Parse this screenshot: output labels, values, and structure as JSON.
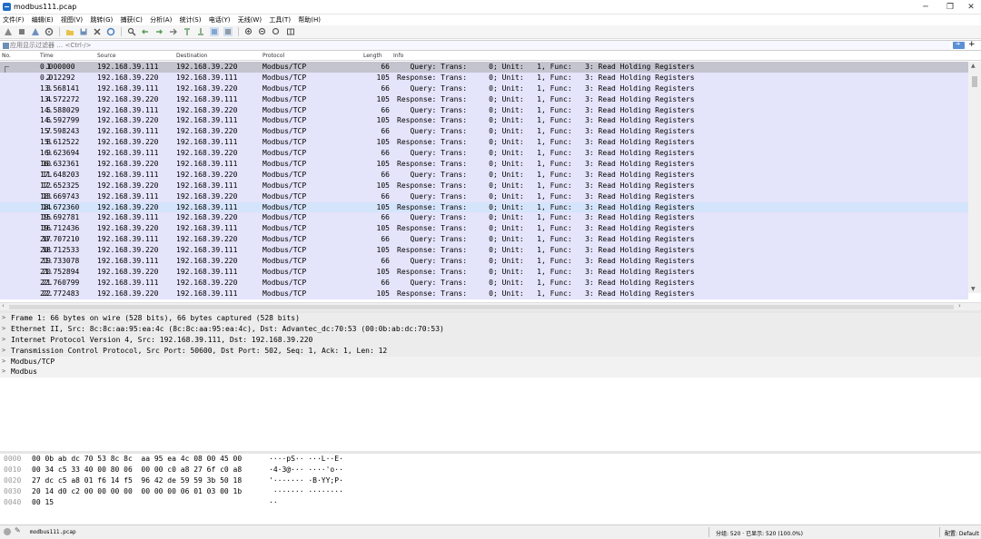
{
  "window": {
    "title": "modbus111.pcap",
    "minimize": "─",
    "maximize": "❐",
    "close": "✕"
  },
  "menu": [
    "文件(F)",
    "编辑(E)",
    "视图(V)",
    "跳转(G)",
    "捕获(C)",
    "分析(A)",
    "统计(S)",
    "电话(Y)",
    "无线(W)",
    "工具(T)",
    "帮助(H)"
  ],
  "filter": {
    "placeholder": "应用显示过滤器 … <Ctrl-/>",
    "plus": "+"
  },
  "columns": {
    "no": "No.",
    "time": "Time",
    "source": "Source",
    "destination": "Destination",
    "protocol": "Protocol",
    "length": "Length",
    "info": "Info"
  },
  "packets": [
    {
      "no": "1",
      "time": "0.000000",
      "src": "192.168.39.111",
      "dst": "192.168.39.220",
      "proto": "Modbus/TCP",
      "len": "66",
      "info": "   Query: Trans:     0; Unit:   1, Func:   3: Read Holding Registers"
    },
    {
      "no": "2",
      "time": "0.012292",
      "src": "192.168.39.220",
      "dst": "192.168.39.111",
      "proto": "Modbus/TCP",
      "len": "105",
      "info": "Response: Trans:     0; Unit:   1, Func:   3: Read Holding Registers"
    },
    {
      "no": "3",
      "time": "13.568141",
      "src": "192.168.39.111",
      "dst": "192.168.39.220",
      "proto": "Modbus/TCP",
      "len": "66",
      "info": "   Query: Trans:     0; Unit:   1, Func:   3: Read Holding Registers"
    },
    {
      "no": "4",
      "time": "13.572272",
      "src": "192.168.39.220",
      "dst": "192.168.39.111",
      "proto": "Modbus/TCP",
      "len": "105",
      "info": "Response: Trans:     0; Unit:   1, Func:   3: Read Holding Registers"
    },
    {
      "no": "5",
      "time": "14.588029",
      "src": "192.168.39.111",
      "dst": "192.168.39.220",
      "proto": "Modbus/TCP",
      "len": "66",
      "info": "   Query: Trans:     0; Unit:   1, Func:   3: Read Holding Registers"
    },
    {
      "no": "6",
      "time": "14.592799",
      "src": "192.168.39.220",
      "dst": "192.168.39.111",
      "proto": "Modbus/TCP",
      "len": "105",
      "info": "Response: Trans:     0; Unit:   1, Func:   3: Read Holding Registers"
    },
    {
      "no": "7",
      "time": "15.598243",
      "src": "192.168.39.111",
      "dst": "192.168.39.220",
      "proto": "Modbus/TCP",
      "len": "66",
      "info": "   Query: Trans:     0; Unit:   1, Func:   3: Read Holding Registers"
    },
    {
      "no": "8",
      "time": "15.612522",
      "src": "192.168.39.220",
      "dst": "192.168.39.111",
      "proto": "Modbus/TCP",
      "len": "105",
      "info": "Response: Trans:     0; Unit:   1, Func:   3: Read Holding Registers"
    },
    {
      "no": "9",
      "time": "16.623694",
      "src": "192.168.39.111",
      "dst": "192.168.39.220",
      "proto": "Modbus/TCP",
      "len": "66",
      "info": "   Query: Trans:     0; Unit:   1, Func:   3: Read Holding Registers"
    },
    {
      "no": "10",
      "time": "16.632361",
      "src": "192.168.39.220",
      "dst": "192.168.39.111",
      "proto": "Modbus/TCP",
      "len": "105",
      "info": "Response: Trans:     0; Unit:   1, Func:   3: Read Holding Registers"
    },
    {
      "no": "11",
      "time": "17.648203",
      "src": "192.168.39.111",
      "dst": "192.168.39.220",
      "proto": "Modbus/TCP",
      "len": "66",
      "info": "   Query: Trans:     0; Unit:   1, Func:   3: Read Holding Registers"
    },
    {
      "no": "12",
      "time": "17.652325",
      "src": "192.168.39.220",
      "dst": "192.168.39.111",
      "proto": "Modbus/TCP",
      "len": "105",
      "info": "Response: Trans:     0; Unit:   1, Func:   3: Read Holding Registers"
    },
    {
      "no": "13",
      "time": "18.669743",
      "src": "192.168.39.111",
      "dst": "192.168.39.220",
      "proto": "Modbus/TCP",
      "len": "66",
      "info": "   Query: Trans:     0; Unit:   1, Func:   3: Read Holding Registers"
    },
    {
      "no": "14",
      "time": "18.672360",
      "src": "192.168.39.220",
      "dst": "192.168.39.111",
      "proto": "Modbus/TCP",
      "len": "105",
      "info": "Response: Trans:     0; Unit:   1, Func:   3: Read Holding Registers"
    },
    {
      "no": "15",
      "time": "19.692781",
      "src": "192.168.39.111",
      "dst": "192.168.39.220",
      "proto": "Modbus/TCP",
      "len": "66",
      "info": "   Query: Trans:     0; Unit:   1, Func:   3: Read Holding Registers"
    },
    {
      "no": "16",
      "time": "19.712436",
      "src": "192.168.39.220",
      "dst": "192.168.39.111",
      "proto": "Modbus/TCP",
      "len": "105",
      "info": "Response: Trans:     0; Unit:   1, Func:   3: Read Holding Registers"
    },
    {
      "no": "17",
      "time": "20.707210",
      "src": "192.168.39.111",
      "dst": "192.168.39.220",
      "proto": "Modbus/TCP",
      "len": "66",
      "info": "   Query: Trans:     0; Unit:   1, Func:   3: Read Holding Registers"
    },
    {
      "no": "18",
      "time": "20.712533",
      "src": "192.168.39.220",
      "dst": "192.168.39.111",
      "proto": "Modbus/TCP",
      "len": "105",
      "info": "Response: Trans:     0; Unit:   1, Func:   3: Read Holding Registers"
    },
    {
      "no": "19",
      "time": "21.733078",
      "src": "192.168.39.111",
      "dst": "192.168.39.220",
      "proto": "Modbus/TCP",
      "len": "66",
      "info": "   Query: Trans:     0; Unit:   1, Func:   3: Read Holding Registers"
    },
    {
      "no": "20",
      "time": "21.752894",
      "src": "192.168.39.220",
      "dst": "192.168.39.111",
      "proto": "Modbus/TCP",
      "len": "105",
      "info": "Response: Trans:     0; Unit:   1, Func:   3: Read Holding Registers"
    },
    {
      "no": "21",
      "time": "22.760799",
      "src": "192.168.39.111",
      "dst": "192.168.39.220",
      "proto": "Modbus/TCP",
      "len": "66",
      "info": "   Query: Trans:     0; Unit:   1, Func:   3: Read Holding Registers"
    },
    {
      "no": "22",
      "time": "22.772483",
      "src": "192.168.39.220",
      "dst": "192.168.39.111",
      "proto": "Modbus/TCP",
      "len": "105",
      "info": "Response: Trans:     0; Unit:   1, Func:   3: Read Holding Registers"
    }
  ],
  "selected_packet": "1",
  "highlighted_packet": "14",
  "details": [
    "Frame 1: 66 bytes on wire (528 bits), 66 bytes captured (528 bits)",
    "Ethernet II, Src: 8c:8c:aa:95:ea:4c (8c:8c:aa:95:ea:4c), Dst: Advantec_dc:70:53 (00:0b:ab:dc:70:53)",
    "Internet Protocol Version 4, Src: 192.168.39.111, Dst: 192.168.39.220",
    "Transmission Control Protocol, Src Port: 50600, Dst Port: 502, Seq: 1, Ack: 1, Len: 12",
    "Modbus/TCP",
    "Modbus"
  ],
  "detail_arrow": ">",
  "bytes": [
    {
      "offset": "0000",
      "hex": "00 0b ab dc 70 53 8c 8c  aa 95 ea 4c 08 00 45 00",
      "ascii": "····pS·· ···L··E·"
    },
    {
      "offset": "0010",
      "hex": "00 34 c5 33 40 00 80 06  00 00 c0 a8 27 6f c0 a8",
      "ascii": "·4·3@··· ····'o··"
    },
    {
      "offset": "0020",
      "hex": "27 dc c5 a8 01 f6 14 f5  96 42 de 59 59 3b 50 18",
      "ascii": "'······· ·B·YY;P·"
    },
    {
      "offset": "0030",
      "hex": "20 14 d0 c2 00 00 00 00  00 00 00 06 01 03 00 1b",
      "ascii": " ······· ········"
    },
    {
      "offset": "0040",
      "hex": "00 15",
      "ascii": "··"
    }
  ],
  "status": {
    "file": "modbus111.pcap",
    "count": "分组: 520 · 已显示: 520 (100.0%)",
    "profile": "配置: Default"
  },
  "colors": {
    "row_bg": "#e4e4fb",
    "row_selected": "#c4c4cf",
    "row_highlight": "#d4e4fb"
  }
}
